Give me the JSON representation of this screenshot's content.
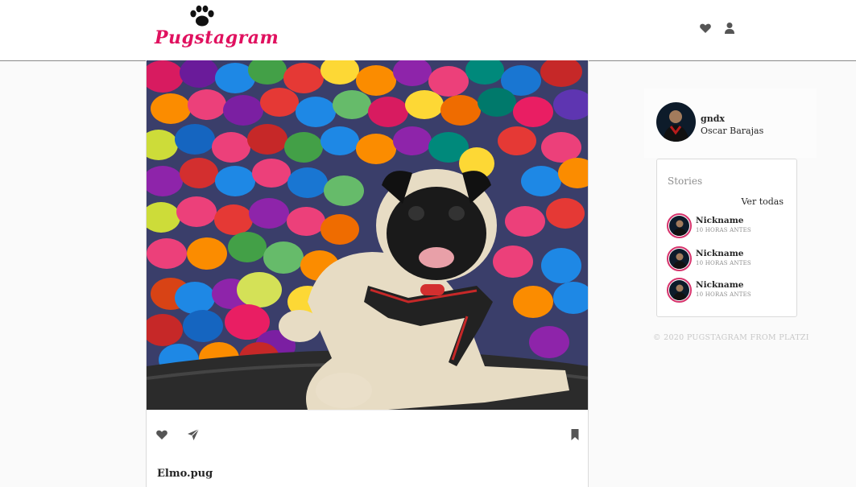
{
  "header": {
    "brand": "Pugstagram",
    "icons": [
      "heart-icon",
      "user-icon"
    ]
  },
  "post": {
    "caption": "Elmo.pug",
    "actions": [
      "heart-icon",
      "send-icon",
      "bookmark-icon"
    ]
  },
  "profile": {
    "username": "gndx",
    "fullname": "Oscar Barajas"
  },
  "stories": {
    "title": "Stories",
    "see_all": "Ver todas",
    "items": [
      {
        "nickname": "Nickname",
        "time": "10 HORAS ANTES"
      },
      {
        "nickname": "Nickname",
        "time": "10 HORAS ANTES"
      },
      {
        "nickname": "Nickname",
        "time": "10 HORAS ANTES"
      }
    ]
  },
  "footer": {
    "text": "© 2020 PUGSTAGRAM FROM PLATZI"
  },
  "colors": {
    "brand_red": "#e0115f",
    "story_ring": "#d6336c",
    "icon_gray": "#555555"
  }
}
